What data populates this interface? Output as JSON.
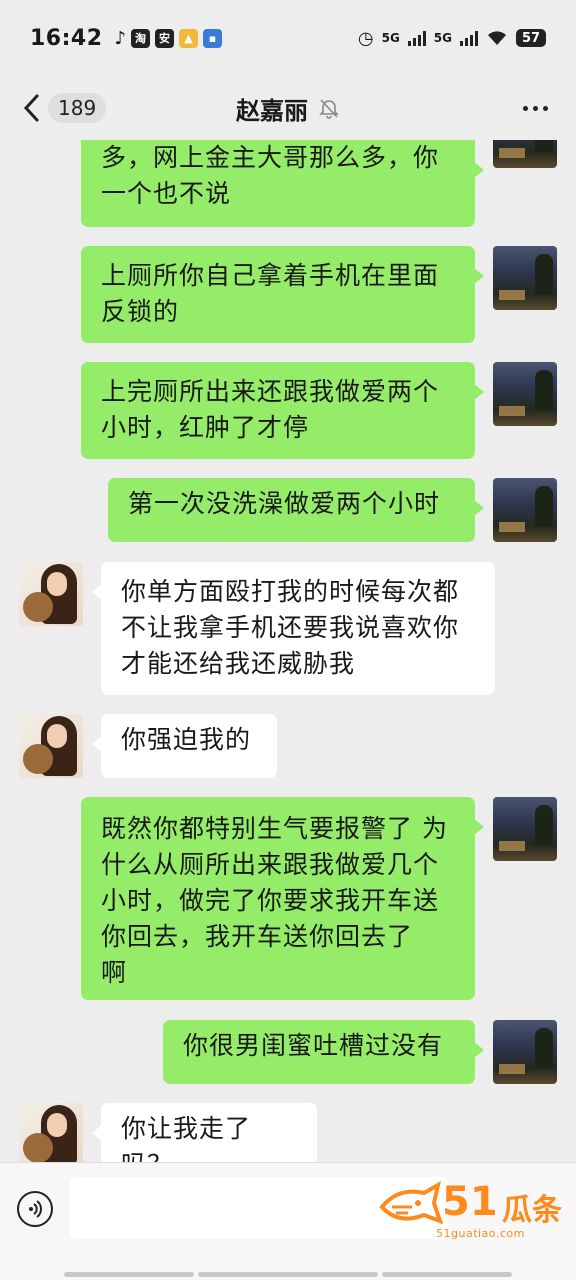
{
  "status_bar": {
    "time": "16:42",
    "battery": "57",
    "network1": "5G",
    "network2": "5G"
  },
  "header": {
    "unread_count": "189",
    "contact_name": "赵嘉丽"
  },
  "messages": [
    {
      "side": "me",
      "text": "多，网上金主大哥那么多，你\n一个也不说"
    },
    {
      "side": "me",
      "text": "上厕所你自己拿着手机在里面\n反锁的"
    },
    {
      "side": "me",
      "text": "上完厕所出来还跟我做爱两个\n小时，红肿了才停"
    },
    {
      "side": "me",
      "text": "第一次没洗澡做爱两个小时"
    },
    {
      "side": "them",
      "text": "你单方面殴打我的时候每次都\n不让我拿手机还要我说喜欢你\n才能还给我还威胁我"
    },
    {
      "side": "them",
      "text": "你强迫我的"
    },
    {
      "side": "me",
      "text": "既然你都特别生气要报警了 为\n什么从厕所出来跟我做爱几个\n小时，做完了你要求我开车送\n你回去，我开车送你回去了\n啊"
    },
    {
      "side": "me",
      "text": "你很男闺蜜吐槽过没有"
    },
    {
      "side": "them",
      "text": "你让我走了吗？"
    }
  ],
  "input": {
    "placeholder": ""
  },
  "watermark": {
    "number": "51",
    "text": "瓜条",
    "url": "51guatiao.com"
  },
  "colors": {
    "my_bubble": "#95ec69",
    "their_bubble": "#ffffff",
    "background": "#ededed",
    "watermark": "#ff8a1c"
  }
}
